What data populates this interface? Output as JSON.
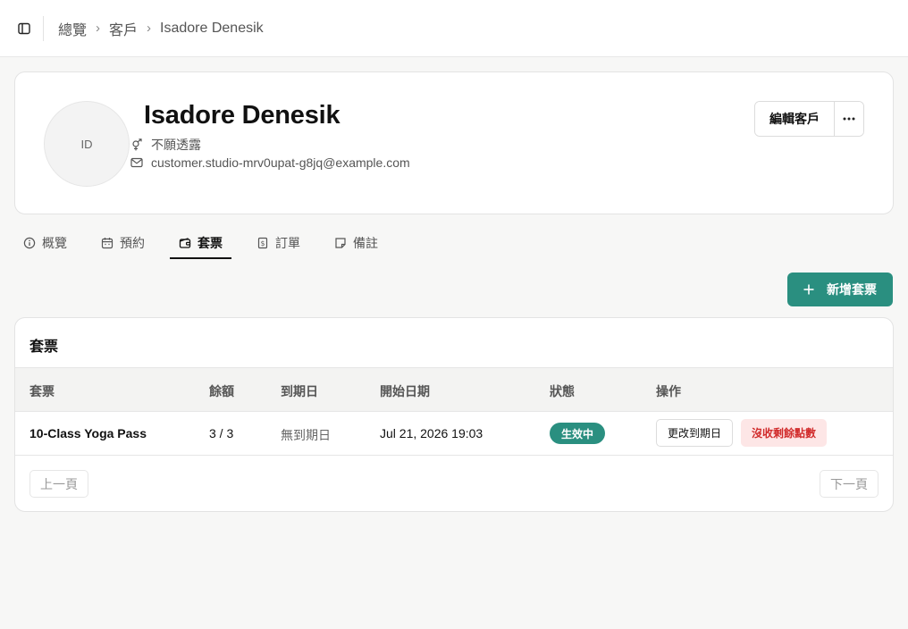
{
  "breadcrumb": {
    "items": [
      "總覽",
      "客戶"
    ],
    "current": "Isadore Denesik"
  },
  "profile": {
    "initials": "ID",
    "name": "Isadore Denesik",
    "gender": "不願透露",
    "email": "customer.studio-mrv0upat-g8jq@example.com",
    "edit_label": "編輯客戶",
    "more_label": "⋯"
  },
  "tabs": [
    {
      "label": "概覽",
      "icon": "info-icon"
    },
    {
      "label": "預約",
      "icon": "calendar-icon"
    },
    {
      "label": "套票",
      "icon": "wallet-icon",
      "active": true
    },
    {
      "label": "訂單",
      "icon": "receipt-icon"
    },
    {
      "label": "備註",
      "icon": "note-icon"
    }
  ],
  "add_button_label": "新增套票",
  "passes": {
    "title": "套票",
    "columns": [
      "套票",
      "餘額",
      "到期日",
      "開始日期",
      "狀態",
      "操作"
    ],
    "rows": [
      {
        "name": "10-Class Yoga Pass",
        "balance": "3 / 3",
        "expiry": "無到期日",
        "start": "Jul 21, 2026 19:03",
        "status": "生效中",
        "action_change": "更改到期日",
        "action_forfeit": "沒收剩餘點數"
      }
    ],
    "prev_label": "上一頁",
    "next_label": "下一頁"
  },
  "colors": {
    "accent": "#2a8f80",
    "danger_text": "#d12b2b",
    "danger_bg": "#fde6e6"
  }
}
